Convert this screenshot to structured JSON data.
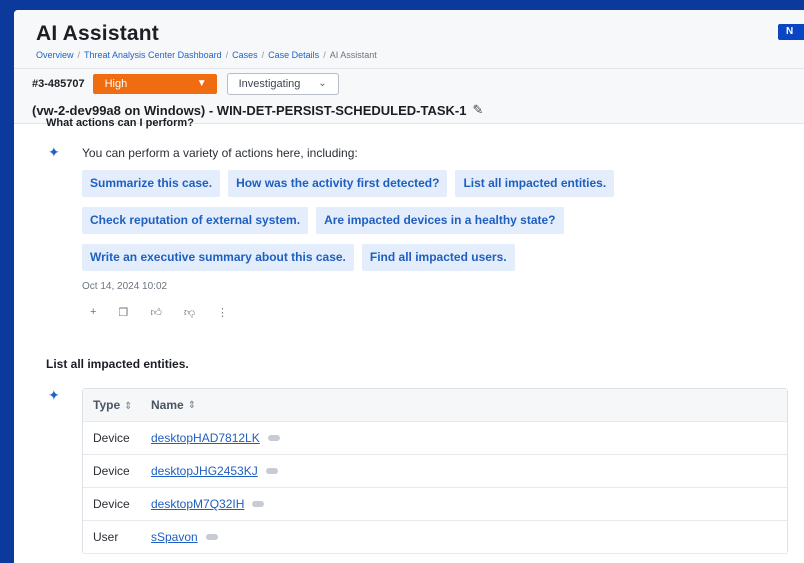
{
  "header": {
    "title": "AI Assistant",
    "breadcrumb": [
      "Overview",
      "Threat Analysis Center Dashboard",
      "Cases",
      "Case Details",
      "AI Assistant"
    ],
    "corner_badge": "N"
  },
  "case": {
    "id": "#3-485707",
    "severity": "High",
    "status": "Investigating",
    "title": "(vw-2-dev99a8 on Windows) - WIN-DET-PERSIST-SCHEDULED-TASK-1"
  },
  "conversation": {
    "question1": "What actions can I perform?",
    "answer_intro": "You can perform a variety of actions here, including:",
    "suggestions": [
      "Summarize this case.",
      "How was the activity first detected?",
      "List all impacted entities.",
      "Check reputation of external system.",
      "Are impacted devices in a healthy state?",
      "Write an executive summary about this case.",
      "Find all impacted users."
    ],
    "timestamp": "Oct 14, 2024 10:02",
    "question2": "List all impacted entities."
  },
  "table": {
    "columns": [
      "Type",
      "Name"
    ],
    "rows": [
      {
        "type": "Device",
        "name": "desktopHAD7812LK"
      },
      {
        "type": "Device",
        "name": "desktopJHG2453KJ"
      },
      {
        "type": "Device",
        "name": "desktopM7Q32IH"
      },
      {
        "type": "User",
        "name": "sSpavon"
      }
    ]
  },
  "colors": {
    "severity_high": "#ef6c10",
    "chip_bg": "#e3edfb",
    "accent": "#1f5fbf",
    "outer_bg": "#0b3a9c"
  }
}
